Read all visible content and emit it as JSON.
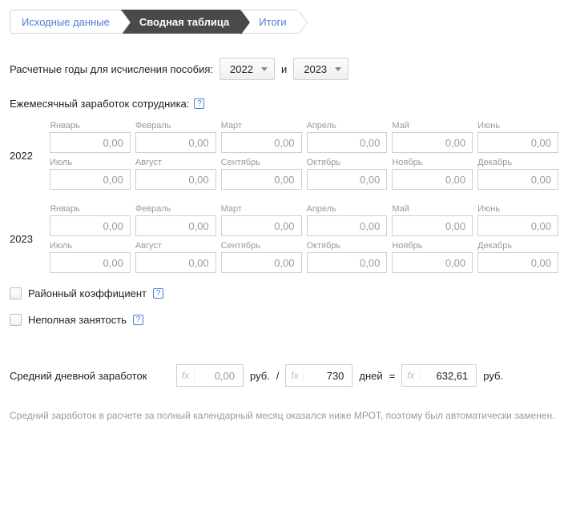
{
  "tabs": {
    "source": "Исходные данные",
    "summary": "Сводная таблица",
    "results": "Итоги"
  },
  "years_label": "Расчетные годы для исчисления пособия:",
  "and": "и",
  "year1": "2022",
  "year2": "2023",
  "monthly_label": "Ежемесячный заработок сотрудника:",
  "months": {
    "m1": "Январь",
    "m2": "Февраль",
    "m3": "Март",
    "m4": "Апрель",
    "m5": "Май",
    "m6": "Июнь",
    "m7": "Июль",
    "m8": "Август",
    "m9": "Сентябрь",
    "m10": "Октябрь",
    "m11": "Ноябрь",
    "m12": "Декабрь"
  },
  "zero": "0,00",
  "district_coef": "Районный коэффициент",
  "part_time": "Неполная занятость",
  "avg": {
    "label": "Средний дневной заработок",
    "earnings": "0,00",
    "unit_rub": "руб.",
    "slash": "/",
    "days": "730",
    "unit_days": "дней",
    "eq": "=",
    "result": "632,61"
  },
  "note": "Средний заработок в расчете за полный календарный месяц оказался ниже МРОТ, поэтому был автоматически заменен."
}
